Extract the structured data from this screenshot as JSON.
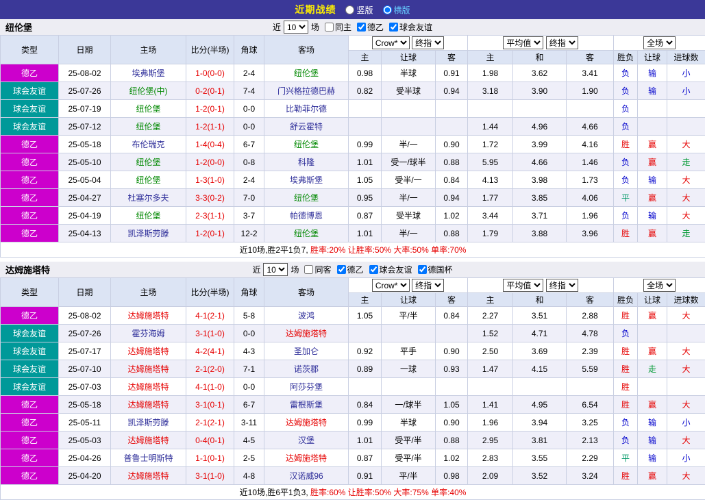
{
  "topbar": {
    "title": "近期战绩",
    "radios": [
      {
        "label": "竖版",
        "selected": false
      },
      {
        "label": "横版",
        "selected": true
      }
    ]
  },
  "selects": {
    "bookmaker": "Crow*",
    "asia_index": "终指",
    "eu_avg": "平均值",
    "eu_index": "终指",
    "scope": "全场"
  },
  "table_header": {
    "type": "类型",
    "date": "日期",
    "home": "主场",
    "score": "比分(半场)",
    "corner": "角球",
    "away": "客场",
    "asia_home": "主",
    "asia_handicap": "让球",
    "asia_away": "客",
    "eu_home": "主",
    "eu_draw": "和",
    "eu_away": "客",
    "result": "胜负",
    "handicap_result": "让球",
    "goals": "进球数"
  },
  "league_colors": {
    "德乙": "#cc00cc",
    "球会友谊": "#009999"
  },
  "result_colors": {
    "胜": "#e60000",
    "负": "#0000cc",
    "平": "#009966",
    "赢": "#e60000",
    "输": "#0000cc",
    "走": "#009933",
    "大": "#e60000",
    "小": "#0000cc"
  },
  "sections": [
    {
      "team": "纽伦堡",
      "team_color": "#008800",
      "filter": {
        "near": "近",
        "count": "10",
        "games": "场",
        "checkboxes": [
          {
            "label": "同主",
            "checked": false
          },
          {
            "label": "德乙",
            "checked": true
          },
          {
            "label": "球会友谊",
            "checked": true
          }
        ]
      },
      "rows": [
        {
          "league": "德乙",
          "date": "25-08-02",
          "home": "埃弗斯堡",
          "home_hl": false,
          "score": "1-0(0-0)",
          "corner": "2-4",
          "away": "纽伦堡",
          "away_hl": true,
          "o1": "0.98",
          "handicap": "半球",
          "o2": "0.91",
          "e1": "1.98",
          "e2": "3.62",
          "e3": "3.41",
          "res": "负",
          "hres": "输",
          "gres": "小"
        },
        {
          "league": "球会友谊",
          "date": "25-07-26",
          "home": "纽伦堡(中)",
          "home_hl": true,
          "score": "0-2(0-1)",
          "corner": "7-4",
          "away": "门兴格拉德巴赫",
          "away_hl": false,
          "o1": "0.82",
          "handicap": "受半球",
          "o2": "0.94",
          "e1": "3.18",
          "e2": "3.90",
          "e3": "1.90",
          "res": "负",
          "hres": "输",
          "gres": "小"
        },
        {
          "league": "球会友谊",
          "date": "25-07-19",
          "home": "纽伦堡",
          "home_hl": true,
          "score": "1-2(0-1)",
          "corner": "0-0",
          "away": "比勒菲尔德",
          "away_hl": false,
          "o1": "",
          "handicap": "",
          "o2": "",
          "e1": "",
          "e2": "",
          "e3": "",
          "res": "负",
          "hres": "",
          "gres": ""
        },
        {
          "league": "球会友谊",
          "date": "25-07-12",
          "home": "纽伦堡",
          "home_hl": true,
          "score": "1-2(1-1)",
          "corner": "0-0",
          "away": "舒云霍特",
          "away_hl": false,
          "o1": "",
          "handicap": "",
          "o2": "",
          "e1": "1.44",
          "e2": "4.96",
          "e3": "4.66",
          "res": "负",
          "hres": "",
          "gres": ""
        },
        {
          "league": "德乙",
          "date": "25-05-18",
          "home": "布伦瑞克",
          "home_hl": false,
          "score": "1-4(0-4)",
          "corner": "6-7",
          "away": "纽伦堡",
          "away_hl": true,
          "o1": "0.99",
          "handicap": "半/一",
          "o2": "0.90",
          "e1": "1.72",
          "e2": "3.99",
          "e3": "4.16",
          "res": "胜",
          "hres": "赢",
          "gres": "大"
        },
        {
          "league": "德乙",
          "date": "25-05-10",
          "home": "纽伦堡",
          "home_hl": true,
          "score": "1-2(0-0)",
          "corner": "0-8",
          "away": "科隆",
          "away_hl": false,
          "o1": "1.01",
          "handicap": "受一/球半",
          "o2": "0.88",
          "e1": "5.95",
          "e2": "4.66",
          "e3": "1.46",
          "res": "负",
          "hres": "赢",
          "gres": "走"
        },
        {
          "league": "德乙",
          "date": "25-05-04",
          "home": "纽伦堡",
          "home_hl": true,
          "score": "1-3(1-0)",
          "corner": "2-4",
          "away": "埃弗斯堡",
          "away_hl": false,
          "o1": "1.05",
          "handicap": "受半/一",
          "o2": "0.84",
          "e1": "4.13",
          "e2": "3.98",
          "e3": "1.73",
          "res": "负",
          "hres": "输",
          "gres": "大"
        },
        {
          "league": "德乙",
          "date": "25-04-27",
          "home": "杜塞尔多夫",
          "home_hl": false,
          "score": "3-3(0-2)",
          "corner": "7-0",
          "away": "纽伦堡",
          "away_hl": true,
          "o1": "0.95",
          "handicap": "半/一",
          "o2": "0.94",
          "e1": "1.77",
          "e2": "3.85",
          "e3": "4.06",
          "res": "平",
          "hres": "赢",
          "gres": "大"
        },
        {
          "league": "德乙",
          "date": "25-04-19",
          "home": "纽伦堡",
          "home_hl": true,
          "score": "2-3(1-1)",
          "corner": "3-7",
          "away": "帕德博恩",
          "away_hl": false,
          "o1": "0.87",
          "handicap": "受半球",
          "o2": "1.02",
          "e1": "3.44",
          "e2": "3.71",
          "e3": "1.96",
          "res": "负",
          "hres": "输",
          "gres": "大"
        },
        {
          "league": "德乙",
          "date": "25-04-13",
          "home": "凯泽斯劳滕",
          "home_hl": false,
          "score": "1-2(0-1)",
          "corner": "12-2",
          "away": "纽伦堡",
          "away_hl": true,
          "o1": "1.01",
          "handicap": "半/一",
          "o2": "0.88",
          "e1": "1.79",
          "e2": "3.88",
          "e3": "3.96",
          "res": "胜",
          "hres": "赢",
          "gres": "走"
        }
      ],
      "summary_prefix": "近10场,胜2平1负7, ",
      "summary_stats": "胜率:20% 让胜率:50% 大率:50% 单率:70%"
    },
    {
      "team": "达姆施塔特",
      "team_color": "#e60000",
      "filter": {
        "near": "近",
        "count": "10",
        "games": "场",
        "checkboxes": [
          {
            "label": "同客",
            "checked": false
          },
          {
            "label": "德乙",
            "checked": true
          },
          {
            "label": "球会友谊",
            "checked": true
          },
          {
            "label": "德国杯",
            "checked": true
          }
        ]
      },
      "rows": [
        {
          "league": "德乙",
          "date": "25-08-02",
          "home": "达姆施塔特",
          "home_hl": true,
          "score": "4-1(2-1)",
          "corner": "5-8",
          "away": "波鸿",
          "away_hl": false,
          "o1": "1.05",
          "handicap": "平/半",
          "o2": "0.84",
          "e1": "2.27",
          "e2": "3.51",
          "e3": "2.88",
          "res": "胜",
          "hres": "赢",
          "gres": "大"
        },
        {
          "league": "球会友谊",
          "date": "25-07-26",
          "home": "霍芬海姆",
          "home_hl": false,
          "score": "3-1(1-0)",
          "corner": "0-0",
          "away": "达姆施塔特",
          "away_hl": true,
          "o1": "",
          "handicap": "",
          "o2": "",
          "e1": "1.52",
          "e2": "4.71",
          "e3": "4.78",
          "res": "负",
          "hres": "",
          "gres": ""
        },
        {
          "league": "球会友谊",
          "date": "25-07-17",
          "home": "达姆施塔特",
          "home_hl": true,
          "score": "4-2(4-1)",
          "corner": "4-3",
          "away": "圣加仑",
          "away_hl": false,
          "o1": "0.92",
          "handicap": "平手",
          "o2": "0.90",
          "e1": "2.50",
          "e2": "3.69",
          "e3": "2.39",
          "res": "胜",
          "hres": "赢",
          "gres": "大"
        },
        {
          "league": "球会友谊",
          "date": "25-07-10",
          "home": "达姆施塔特",
          "home_hl": true,
          "score": "2-1(2-0)",
          "corner": "7-1",
          "away": "诺茨郡",
          "away_hl": false,
          "o1": "0.89",
          "handicap": "一球",
          "o2": "0.93",
          "e1": "1.47",
          "e2": "4.15",
          "e3": "5.59",
          "res": "胜",
          "hres": "走",
          "gres": "大"
        },
        {
          "league": "球会友谊",
          "date": "25-07-03",
          "home": "达姆施塔特",
          "home_hl": true,
          "score": "4-1(1-0)",
          "corner": "0-0",
          "away": "阿莎芬堡",
          "away_hl": false,
          "o1": "",
          "handicap": "",
          "o2": "",
          "e1": "",
          "e2": "",
          "e3": "",
          "res": "胜",
          "hres": "",
          "gres": ""
        },
        {
          "league": "德乙",
          "date": "25-05-18",
          "home": "达姆施塔特",
          "home_hl": true,
          "score": "3-1(0-1)",
          "corner": "6-7",
          "away": "雷根斯堡",
          "away_hl": false,
          "o1": "0.84",
          "handicap": "一/球半",
          "o2": "1.05",
          "e1": "1.41",
          "e2": "4.95",
          "e3": "6.54",
          "res": "胜",
          "hres": "赢",
          "gres": "大"
        },
        {
          "league": "德乙",
          "date": "25-05-11",
          "home": "凯泽斯劳滕",
          "home_hl": false,
          "score": "2-1(2-1)",
          "corner": "3-11",
          "away": "达姆施塔特",
          "away_hl": true,
          "o1": "0.99",
          "handicap": "半球",
          "o2": "0.90",
          "e1": "1.96",
          "e2": "3.94",
          "e3": "3.25",
          "res": "负",
          "hres": "输",
          "gres": "小"
        },
        {
          "league": "德乙",
          "date": "25-05-03",
          "home": "达姆施塔特",
          "home_hl": true,
          "score": "0-4(0-1)",
          "corner": "4-5",
          "away": "汉堡",
          "away_hl": false,
          "o1": "1.01",
          "handicap": "受平/半",
          "o2": "0.88",
          "e1": "2.95",
          "e2": "3.81",
          "e3": "2.13",
          "res": "负",
          "hres": "输",
          "gres": "大"
        },
        {
          "league": "德乙",
          "date": "25-04-26",
          "home": "普鲁士明斯特",
          "home_hl": false,
          "score": "1-1(0-1)",
          "corner": "2-5",
          "away": "达姆施塔特",
          "away_hl": true,
          "o1": "0.87",
          "handicap": "受平/半",
          "o2": "1.02",
          "e1": "2.83",
          "e2": "3.55",
          "e3": "2.29",
          "res": "平",
          "hres": "输",
          "gres": "小"
        },
        {
          "league": "德乙",
          "date": "25-04-20",
          "home": "达姆施塔特",
          "home_hl": true,
          "score": "3-1(1-0)",
          "corner": "4-8",
          "away": "汉诺威96",
          "away_hl": false,
          "o1": "0.91",
          "handicap": "平/半",
          "o2": "0.98",
          "e1": "2.09",
          "e2": "3.52",
          "e3": "3.24",
          "res": "胜",
          "hres": "赢",
          "gres": "大"
        }
      ],
      "summary_prefix": "近10场,胜6平1负3, ",
      "summary_stats": "胜率:60% 让胜率:50% 大率:75% 单率:40%"
    }
  ]
}
